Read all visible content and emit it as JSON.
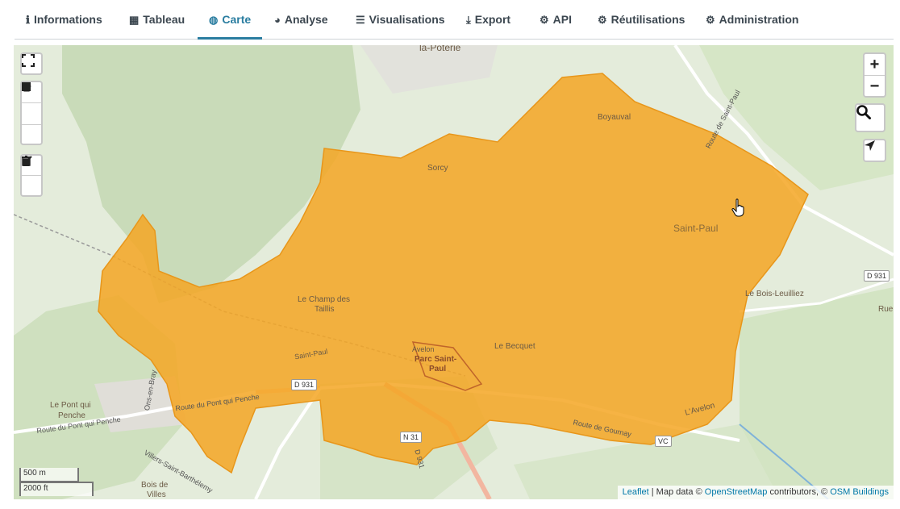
{
  "tabs": [
    {
      "label": "Informations",
      "icon": "info-circle-icon",
      "glyph": "ℹ",
      "active": false
    },
    {
      "label": "Tableau",
      "icon": "table-icon",
      "glyph": "▦",
      "active": false
    },
    {
      "label": "Carte",
      "icon": "globe-icon",
      "glyph": "◍",
      "active": true
    },
    {
      "label": "Analyse",
      "icon": "pie-chart-icon",
      "glyph": "◕",
      "active": false
    },
    {
      "label": "Visualisations",
      "icon": "list-icon",
      "glyph": "☰",
      "active": false
    },
    {
      "label": "Export",
      "icon": "download-icon",
      "glyph": "⤓",
      "active": false
    },
    {
      "label": "API",
      "icon": "cogs-icon",
      "glyph": "⚙",
      "active": false
    },
    {
      "label": "Réutilisations",
      "icon": "cogs-icon",
      "glyph": "⚙",
      "active": false
    },
    {
      "label": "Administration",
      "icon": "cogs-icon",
      "glyph": "⚙",
      "active": false
    }
  ],
  "colors": {
    "accent": "#2a7da0",
    "polygon_fill": "#f5a623",
    "polygon_stroke": "#e8961a"
  },
  "map": {
    "place_labels": {
      "la_poterie": "la-Poterie",
      "boyauval": "Boyauval",
      "sorcy": "Sorcy",
      "saint_paul": "Saint-Paul",
      "le_champ_des": "Le Champ des",
      "taillis": "Taillis",
      "le_becquet": "Le Becquet",
      "parc_saint": "Parc Saint-",
      "paul": "Paul",
      "aveion": "Avelon",
      "saint_paul_road": "Saint-Paul",
      "le_bois_leuilliez": "Le Bois-Leuilliez",
      "le_pont_qui": "Le Pont qui",
      "penche": "Penche",
      "rue": "Rue",
      "bois_de": "Bois de",
      "villes": "Villes",
      "l_avelon": "L'Avelon"
    },
    "road_labels": {
      "route_st_paul": "Route de Saint-Paul",
      "route_pont_qui_penche_1": "Route du Pont qui Penche",
      "route_pont_qui_penche_2": "Route du Pont qui Penche",
      "route_de_gournay": "Route de Gournay",
      "villers_saint_barthelemy": "Villers-Saint-Barthélemy",
      "ons_en_bray": "Ons-en-Bray",
      "d_road": "D 931"
    },
    "shields": {
      "d931_left": "D 931",
      "d931_right": "D 931",
      "n31": "N 31",
      "vc": "VC"
    },
    "controls": {
      "fullscreen_icon": "fullscreen-icon",
      "zoom_in": "+",
      "zoom_out": "−",
      "search_icon": "search-icon",
      "locate_icon": "location-arrow-icon",
      "draw_polygon_icon": "polygon-icon",
      "draw_rectangle_icon": "square-icon",
      "draw_circle_icon": "circle-icon",
      "edit_icon": "edit-icon",
      "delete_icon": "trash-icon"
    },
    "scale": {
      "metric": "500 m",
      "imperial": "2000 ft"
    },
    "attribution": {
      "leaflet": "Leaflet",
      "sep1": " | Map data © ",
      "osm": "OpenStreetMap",
      "sep2": " contributors, © ",
      "osmb": "OSM Buildings"
    }
  }
}
